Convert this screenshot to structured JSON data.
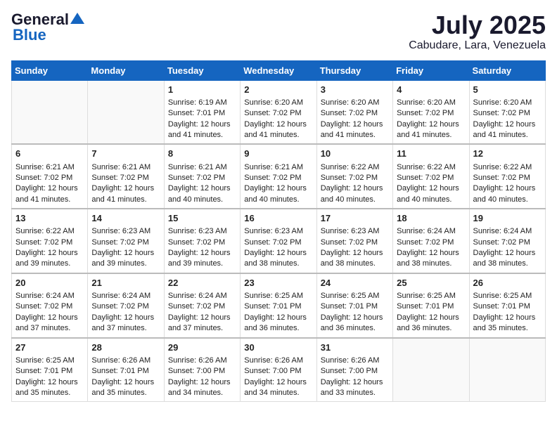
{
  "logo": {
    "general": "General",
    "blue": "Blue"
  },
  "header": {
    "month": "July 2025",
    "location": "Cabudare, Lara, Venezuela"
  },
  "weekdays": [
    "Sunday",
    "Monday",
    "Tuesday",
    "Wednesday",
    "Thursday",
    "Friday",
    "Saturday"
  ],
  "weeks": [
    [
      {
        "day": "",
        "sunrise": "",
        "sunset": "",
        "daylight": ""
      },
      {
        "day": "",
        "sunrise": "",
        "sunset": "",
        "daylight": ""
      },
      {
        "day": "1",
        "sunrise": "Sunrise: 6:19 AM",
        "sunset": "Sunset: 7:01 PM",
        "daylight": "Daylight: 12 hours and 41 minutes."
      },
      {
        "day": "2",
        "sunrise": "Sunrise: 6:20 AM",
        "sunset": "Sunset: 7:02 PM",
        "daylight": "Daylight: 12 hours and 41 minutes."
      },
      {
        "day": "3",
        "sunrise": "Sunrise: 6:20 AM",
        "sunset": "Sunset: 7:02 PM",
        "daylight": "Daylight: 12 hours and 41 minutes."
      },
      {
        "day": "4",
        "sunrise": "Sunrise: 6:20 AM",
        "sunset": "Sunset: 7:02 PM",
        "daylight": "Daylight: 12 hours and 41 minutes."
      },
      {
        "day": "5",
        "sunrise": "Sunrise: 6:20 AM",
        "sunset": "Sunset: 7:02 PM",
        "daylight": "Daylight: 12 hours and 41 minutes."
      }
    ],
    [
      {
        "day": "6",
        "sunrise": "Sunrise: 6:21 AM",
        "sunset": "Sunset: 7:02 PM",
        "daylight": "Daylight: 12 hours and 41 minutes."
      },
      {
        "day": "7",
        "sunrise": "Sunrise: 6:21 AM",
        "sunset": "Sunset: 7:02 PM",
        "daylight": "Daylight: 12 hours and 41 minutes."
      },
      {
        "day": "8",
        "sunrise": "Sunrise: 6:21 AM",
        "sunset": "Sunset: 7:02 PM",
        "daylight": "Daylight: 12 hours and 40 minutes."
      },
      {
        "day": "9",
        "sunrise": "Sunrise: 6:21 AM",
        "sunset": "Sunset: 7:02 PM",
        "daylight": "Daylight: 12 hours and 40 minutes."
      },
      {
        "day": "10",
        "sunrise": "Sunrise: 6:22 AM",
        "sunset": "Sunset: 7:02 PM",
        "daylight": "Daylight: 12 hours and 40 minutes."
      },
      {
        "day": "11",
        "sunrise": "Sunrise: 6:22 AM",
        "sunset": "Sunset: 7:02 PM",
        "daylight": "Daylight: 12 hours and 40 minutes."
      },
      {
        "day": "12",
        "sunrise": "Sunrise: 6:22 AM",
        "sunset": "Sunset: 7:02 PM",
        "daylight": "Daylight: 12 hours and 40 minutes."
      }
    ],
    [
      {
        "day": "13",
        "sunrise": "Sunrise: 6:22 AM",
        "sunset": "Sunset: 7:02 PM",
        "daylight": "Daylight: 12 hours and 39 minutes."
      },
      {
        "day": "14",
        "sunrise": "Sunrise: 6:23 AM",
        "sunset": "Sunset: 7:02 PM",
        "daylight": "Daylight: 12 hours and 39 minutes."
      },
      {
        "day": "15",
        "sunrise": "Sunrise: 6:23 AM",
        "sunset": "Sunset: 7:02 PM",
        "daylight": "Daylight: 12 hours and 39 minutes."
      },
      {
        "day": "16",
        "sunrise": "Sunrise: 6:23 AM",
        "sunset": "Sunset: 7:02 PM",
        "daylight": "Daylight: 12 hours and 38 minutes."
      },
      {
        "day": "17",
        "sunrise": "Sunrise: 6:23 AM",
        "sunset": "Sunset: 7:02 PM",
        "daylight": "Daylight: 12 hours and 38 minutes."
      },
      {
        "day": "18",
        "sunrise": "Sunrise: 6:24 AM",
        "sunset": "Sunset: 7:02 PM",
        "daylight": "Daylight: 12 hours and 38 minutes."
      },
      {
        "day": "19",
        "sunrise": "Sunrise: 6:24 AM",
        "sunset": "Sunset: 7:02 PM",
        "daylight": "Daylight: 12 hours and 38 minutes."
      }
    ],
    [
      {
        "day": "20",
        "sunrise": "Sunrise: 6:24 AM",
        "sunset": "Sunset: 7:02 PM",
        "daylight": "Daylight: 12 hours and 37 minutes."
      },
      {
        "day": "21",
        "sunrise": "Sunrise: 6:24 AM",
        "sunset": "Sunset: 7:02 PM",
        "daylight": "Daylight: 12 hours and 37 minutes."
      },
      {
        "day": "22",
        "sunrise": "Sunrise: 6:24 AM",
        "sunset": "Sunset: 7:02 PM",
        "daylight": "Daylight: 12 hours and 37 minutes."
      },
      {
        "day": "23",
        "sunrise": "Sunrise: 6:25 AM",
        "sunset": "Sunset: 7:01 PM",
        "daylight": "Daylight: 12 hours and 36 minutes."
      },
      {
        "day": "24",
        "sunrise": "Sunrise: 6:25 AM",
        "sunset": "Sunset: 7:01 PM",
        "daylight": "Daylight: 12 hours and 36 minutes."
      },
      {
        "day": "25",
        "sunrise": "Sunrise: 6:25 AM",
        "sunset": "Sunset: 7:01 PM",
        "daylight": "Daylight: 12 hours and 36 minutes."
      },
      {
        "day": "26",
        "sunrise": "Sunrise: 6:25 AM",
        "sunset": "Sunset: 7:01 PM",
        "daylight": "Daylight: 12 hours and 35 minutes."
      }
    ],
    [
      {
        "day": "27",
        "sunrise": "Sunrise: 6:25 AM",
        "sunset": "Sunset: 7:01 PM",
        "daylight": "Daylight: 12 hours and 35 minutes."
      },
      {
        "day": "28",
        "sunrise": "Sunrise: 6:26 AM",
        "sunset": "Sunset: 7:01 PM",
        "daylight": "Daylight: 12 hours and 35 minutes."
      },
      {
        "day": "29",
        "sunrise": "Sunrise: 6:26 AM",
        "sunset": "Sunset: 7:00 PM",
        "daylight": "Daylight: 12 hours and 34 minutes."
      },
      {
        "day": "30",
        "sunrise": "Sunrise: 6:26 AM",
        "sunset": "Sunset: 7:00 PM",
        "daylight": "Daylight: 12 hours and 34 minutes."
      },
      {
        "day": "31",
        "sunrise": "Sunrise: 6:26 AM",
        "sunset": "Sunset: 7:00 PM",
        "daylight": "Daylight: 12 hours and 33 minutes."
      },
      {
        "day": "",
        "sunrise": "",
        "sunset": "",
        "daylight": ""
      },
      {
        "day": "",
        "sunrise": "",
        "sunset": "",
        "daylight": ""
      }
    ]
  ]
}
